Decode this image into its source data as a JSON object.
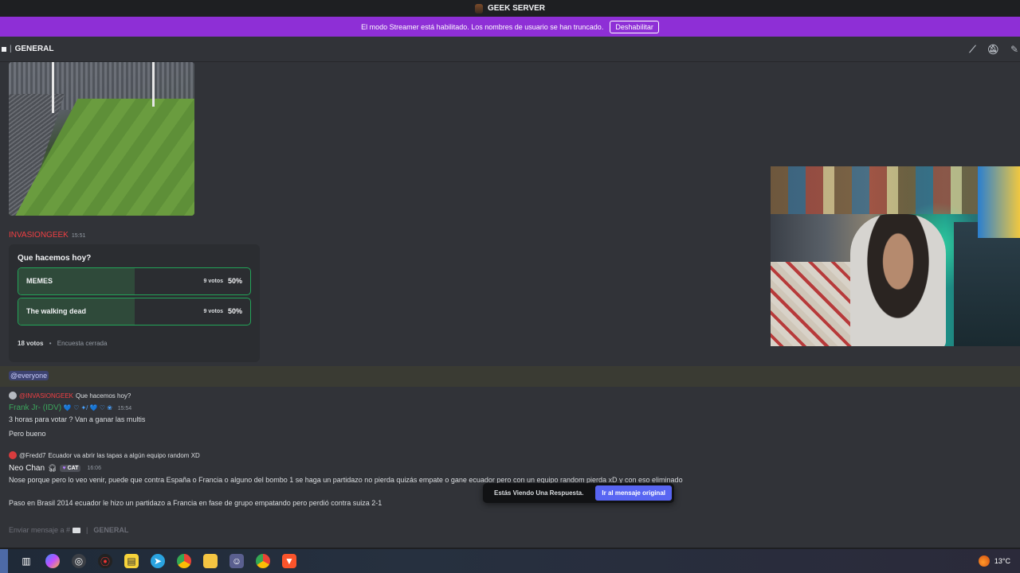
{
  "window": {
    "server_name": "GEEK SERVER"
  },
  "streamer_banner": {
    "message": "El modo Streamer está habilitado. Los nombres de usuario se han truncado.",
    "disable_label": "Deshabilitar"
  },
  "header": {
    "channel_name": "GENERAL",
    "separator": "|",
    "icons": [
      "threads-icon",
      "mute-icon",
      "pin-icon"
    ]
  },
  "messages": {
    "poll_message": {
      "author": "INVASIONGEEK",
      "author_color": "#f23f43",
      "time": "15:51",
      "poll": {
        "question": "Que hacemos hoy?",
        "options": [
          {
            "label": "MEMES",
            "votes": "9 votos",
            "percent": "50%",
            "fraction": 0.5
          },
          {
            "label": "The walking dead",
            "votes": "9 votos",
            "percent": "50%",
            "fraction": 0.5
          }
        ],
        "total_votes": "18 votos",
        "separator": "•",
        "status": "Encuesta cerrada"
      }
    },
    "mention": "@everyone",
    "reply1": {
      "reply_author": "@INVASIONGEEK",
      "reply_text": "Que hacemos hoy?",
      "author": "Frank Jr- (IDV)",
      "author_color": "#3ba55c",
      "time": "15:54",
      "lines": [
        "3 horas para votar ? Van a ganar las multis",
        "Pero bueno"
      ]
    },
    "reply2": {
      "reply_author": "@Fredd7",
      "reply_text": "Ecuador va abrir las tapas a algún equipo random XD",
      "author": "Neo Chan",
      "role_tag": "CAT",
      "time": "16:06",
      "lines": [
        "Nose porque pero lo veo venir, puede que contra España o Francia o alguno del bombo 1 se haga un partidazo no pierda quizás empate o gane ecuador pero con un equipo random pierda xD y con eso eliminado",
        "Paso en Brasil 2014 ecuador le hizo un partidazo a Francia en fase de grupo empatando pero perdió contra suiza 2-1"
      ]
    }
  },
  "toast": {
    "text": "Estás Viendo Una Respuesta.",
    "button": "Ir al mensaje original"
  },
  "composer": {
    "placeholder_prefix": "Enviar mensaje a #",
    "separator": "|",
    "channel": "GENERAL"
  },
  "taskbar": {
    "apps": [
      "task-view-icon",
      "copilot-icon",
      "obs-icon",
      "capture-icon",
      "sticky-notes-icon",
      "telegram-icon",
      "chrome-icon",
      "file-explorer-icon",
      "discord-icon",
      "chrome-profile-icon",
      "brave-icon"
    ],
    "temperature": "13°C"
  }
}
